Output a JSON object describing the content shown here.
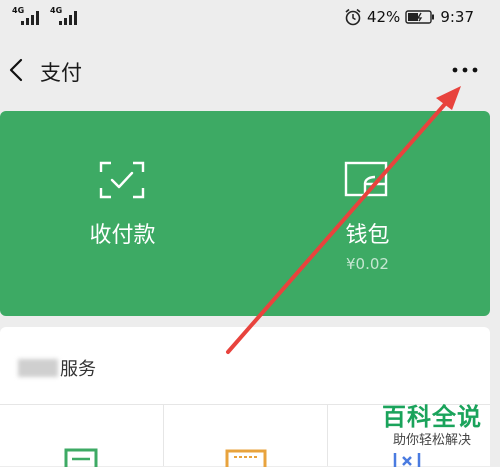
{
  "status_bar": {
    "signal_1": "4G",
    "signal_2": "4G",
    "battery_percent": "42%",
    "time": "9:37"
  },
  "header": {
    "title": "支付"
  },
  "main_card": {
    "pay": {
      "label": "收付款",
      "icon": "scan-check-icon"
    },
    "wallet": {
      "label": "钱包",
      "amount": "¥0.02",
      "icon": "wallet-icon"
    }
  },
  "services": {
    "title": "服务"
  },
  "watermark": {
    "title": "百科全说",
    "subtitle": "助你轻松解决"
  },
  "colors": {
    "card_green": "#3daa64",
    "annotation_red": "#e8433d",
    "watermark_green": "#1aa35b"
  }
}
